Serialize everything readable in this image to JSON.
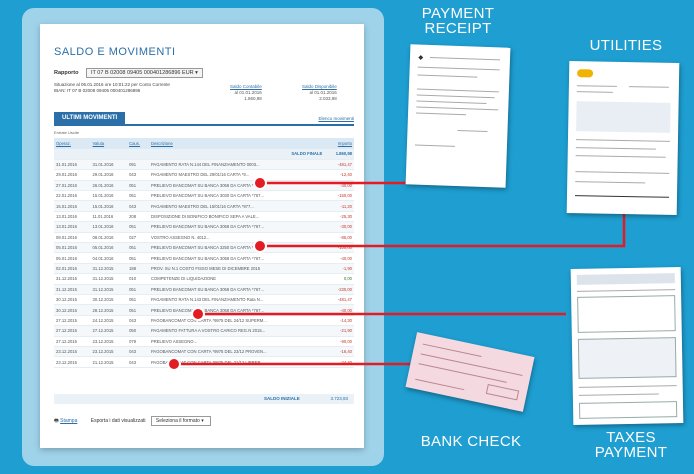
{
  "statement": {
    "title": "SALDO E MOVIMENTI",
    "rapporto_label": "Rapporto",
    "rapporto_value": "IT 07 B 02008 09405 000401286896 EUR",
    "situazione": "Situazione al 06.01.2016 ore 10:01:22 per Conto Corrente",
    "situazione_line2": "IBAN: IT 07 B 02008 09405 000401286896",
    "saldo_contabile_label": "Saldo Contabile",
    "saldo_contabile_date": "al 01.01.2016",
    "saldo_contabile_value": "1.860,98",
    "saldo_disponibile_label": "Saldo Disponibile",
    "saldo_disponibile_date": "al 01.01.2016",
    "saldo_disponibile_value": "2.033,98",
    "tab_label": "ULTIMI MOVIMENTI",
    "tab_right_link": "Elenco movimenti",
    "filter_note": "Entrate Uscite",
    "columns": [
      "Operaz.",
      "Valuta",
      "Caus.",
      "Descrizione",
      "Importo"
    ],
    "saldo_finale_label": "SALDO FINALE",
    "saldo_finale_value": "1.860,98",
    "rows": [
      [
        "31.01.2016",
        "31.01.2016",
        "091",
        "PAGAMENTO RATA N.144 DEL FINANZIAMENTO 0003...",
        "-481,47"
      ],
      [
        "29.01.2016",
        "29.01.2016",
        "043",
        "PAGAMENTO MAESTRO DEL 29/01/16 CARTA *9...",
        "-12,40"
      ],
      [
        "27.01.2016",
        "26.01.2016",
        "051",
        "PRELIEVO BANCOMAT SU BANCA 3058 DA CARTA *767...",
        "-30,00"
      ],
      [
        "22.01.2016",
        "15.01.2016",
        "051",
        "PRELIEVO BANCOMAT SU BANCA 3030 DA CARTA *767...",
        "-150,00"
      ],
      [
        "15.01.2016",
        "15.01.2016",
        "043",
        "PAGAMENTO MAESTRO DEL 15/01/16 CARTA *977...",
        "-11,20"
      ],
      [
        "13.01.2016",
        "11.01.2016",
        "208",
        "DISPOSIZIONE DI BONIFICO BONIFICO SEPA A VALE...",
        "-25,30"
      ],
      [
        "13.01.2016",
        "13.01.2016",
        "051",
        "PRELIEVO BANCOMAT SU BANCA 3058 DA CARTA *767...",
        "-30,00"
      ],
      [
        "08.01.2016",
        "08.01.2016",
        "027",
        "VOSTRO ASSEGNO N. 4012...",
        "-85,00"
      ],
      [
        "05.01.2016",
        "05.01.2016",
        "051",
        "PRELIEVO BANCOMAT SU BANCA 3250 DA CARTA *767...",
        "-100,00"
      ],
      [
        "05.01.2016",
        "04.01.2016",
        "051",
        "PRELIEVO BANCOMAT SU BANCA 3058 DA CARTA *767...",
        "-40,00"
      ],
      [
        "02.01.2016",
        "31.12.2015",
        "188",
        "PROV. SU N.1 COSTO FISSO MESE DI DICEMBRE 2015",
        "-1,90"
      ],
      [
        "31.12.2015",
        "31.12.2015",
        "010",
        "COMPETENZE DI LIQUIDAZIONE",
        "0,00"
      ],
      [
        "31.12.2015",
        "31.12.2015",
        "051",
        "PRELIEVO BANCOMAT SU BANCA 3058 DA CARTA *767...",
        "-230,00"
      ],
      [
        "30.12.2015",
        "30.12.2015",
        "051",
        "PAGAMENTO RATA N.143 DEL FINANZIAMENTO Rata N...",
        "-481,47"
      ],
      [
        "30.12.2015",
        "28.12.2015",
        "051",
        "PRELIEVO BANCOMAT SU BANCA 3058 DA CARTA *767...",
        "-40,00"
      ],
      [
        "27.12.2015",
        "24.12.2015",
        "043",
        "PAGOBANCOMAT CON CARTA *9975 DEL 24/12 SUPERM...",
        "-14,30"
      ],
      [
        "27.12.2015",
        "27.12.2015",
        "050",
        "PAGAMENTO FATTURA A VOSTRO CARICO REG.N 2015...",
        "-21,90"
      ],
      [
        "27.12.2015",
        "23.12.2015",
        "079",
        "PRELIEVO ASSEGNO...",
        "-90,00"
      ],
      [
        "23.12.2015",
        "23.12.2015",
        "043",
        "PAGOBANCOMAT CON CARTA *9975 DEL 23/12 PROVEN...",
        "-16,40"
      ],
      [
        "23.12.2015",
        "21.12.2015",
        "043",
        "PAGOBANCOMAT CON CARTA *9975 DEL 21/12 LIBRER...",
        "-24,40"
      ]
    ],
    "saldo_iniziale_label": "SALDO INIZIALE",
    "saldo_iniziale_value": "3.723,93",
    "stampa_label": "Stampa",
    "esporta_label": "Esporta i dati visualizzati",
    "format_select": "Seleziona il formato"
  },
  "captions": {
    "payment_receipt_line1": "PAYMENT",
    "payment_receipt_line2": "RECEIPT",
    "utilities": "UTILITIES",
    "bank_check": "BANK CHECK",
    "taxes_line1": "TAXES",
    "taxes_line2": "PAYMENT"
  },
  "colors": {
    "background": "#1e9ed1",
    "accent": "#2b6fa8",
    "marker": "#e31b23"
  }
}
